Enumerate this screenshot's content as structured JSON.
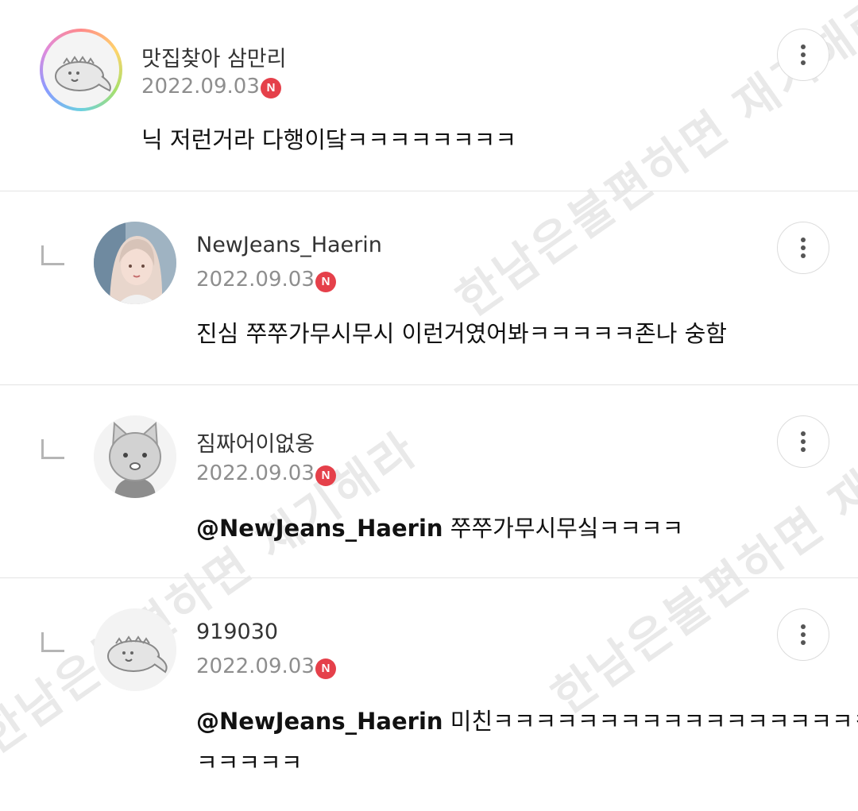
{
  "watermark": "한남은불편하면 재기해라",
  "comments": [
    {
      "author": "맛집찾아 삼만리",
      "date": "2022.09.03",
      "badge": "N",
      "mention": "",
      "text": "닉 저런거라 다행이닼ㅋㅋㅋㅋㅋㅋㅋㅋ",
      "avatar_icon": "dinosaur-avatar-icon",
      "is_reply": false
    },
    {
      "author": "NewJeans_Haerin",
      "date": "2022.09.03",
      "badge": "N",
      "mention": "",
      "text": "진심 쭈쭈가무시무시 이런거였어봐ㅋㅋㅋㅋㅋ존나 숭함",
      "avatar_icon": "profile-photo",
      "is_reply": true
    },
    {
      "author": "짐짜어이없옹",
      "date": "2022.09.03",
      "badge": "N",
      "mention": "@NewJeans_Haerin",
      "text": " 쭈쭈가무시무싴ㅋㅋㅋㅋ",
      "avatar_icon": "cat-avatar-icon",
      "is_reply": true
    },
    {
      "author": "919030",
      "date": "2022.09.03",
      "badge": "N",
      "mention": "@NewJeans_Haerin",
      "text": " 미친ㅋㅋㅋㅋㅋㅋㅋㅋㅋㅋㅋㅋㅋㅋㅋㅋㅋㅋㅋ",
      "text_line2": "ㅋㅋㅋㅋㅋ",
      "avatar_icon": "dinosaur-avatar-icon",
      "is_reply": true
    }
  ],
  "colors": {
    "badge": "#e5404a",
    "divider": "#e3e3e3",
    "date": "#8e8e8e"
  },
  "icons": {
    "more": "more-vertical-icon",
    "reply": "reply-arrow-icon",
    "badge": "new-badge-icon"
  }
}
